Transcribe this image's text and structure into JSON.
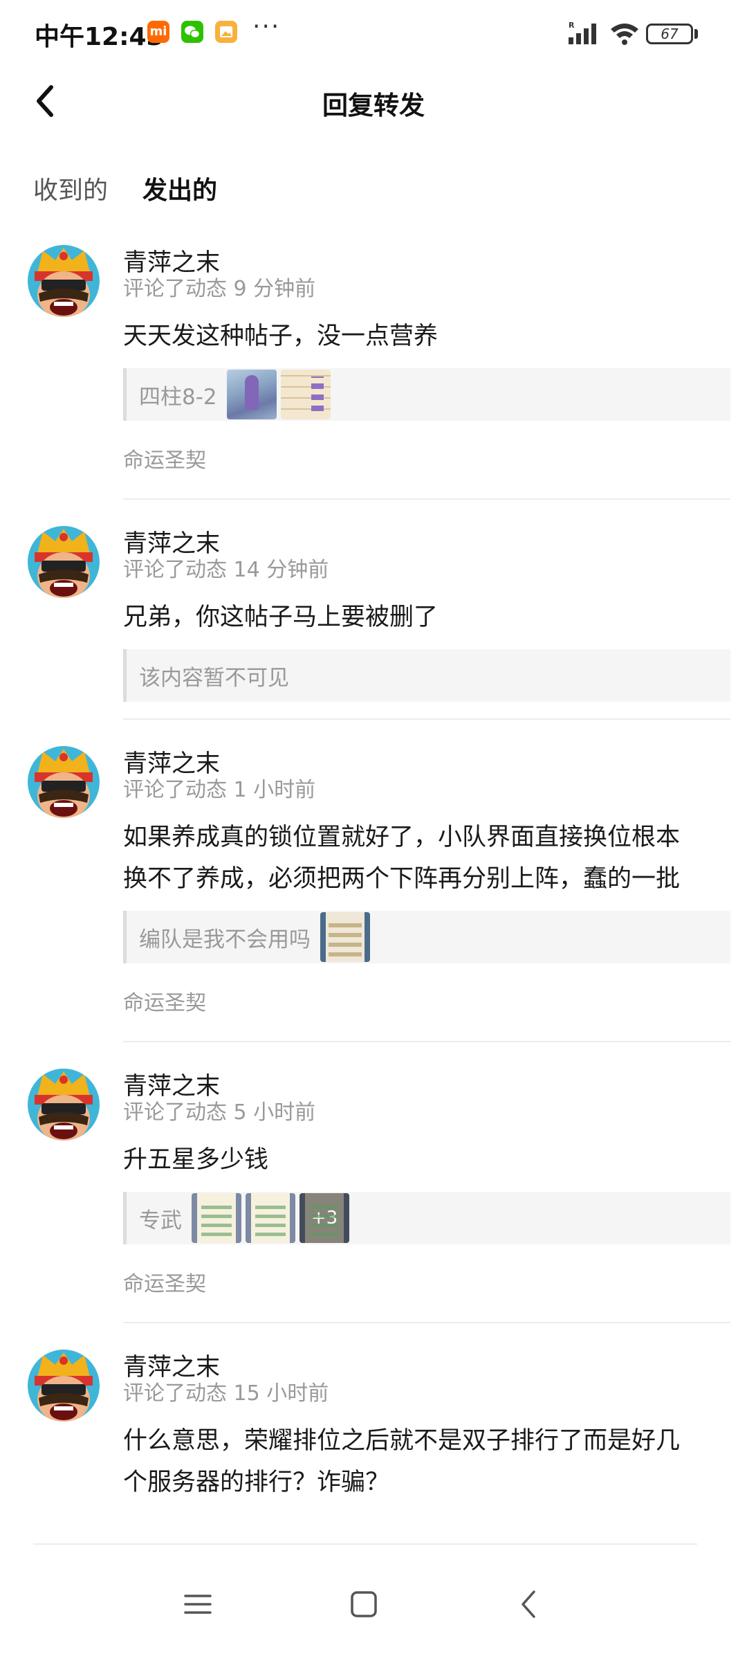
{
  "status_bar": {
    "time": "中午12:43",
    "app_icons": [
      "mi-icon",
      "wechat-icon",
      "gallery-icon"
    ],
    "more": "···",
    "battery": "67"
  },
  "header": {
    "title": "回复转发",
    "back_icon": "chevron-left-icon"
  },
  "tabs": [
    {
      "label": "收到的",
      "active": false
    },
    {
      "label": "发出的",
      "active": true
    }
  ],
  "accent_color": "#1ec9b8",
  "items": [
    {
      "username": "青萍之末",
      "meta": "评论了动态 9 分钟前",
      "content": "天天发这种帖子，没一点营养",
      "quote": {
        "text": "四柱8-2",
        "thumbs": [
          "scene",
          "grid"
        ],
        "more": ""
      },
      "tag": "命运圣契"
    },
    {
      "username": "青萍之末",
      "meta": "评论了动态 14 分钟前",
      "content": "兄弟，你这帖子马上要被删了",
      "quote": {
        "text": "该内容暂不可见",
        "thumbs": [],
        "more": ""
      },
      "tag": ""
    },
    {
      "username": "青萍之末",
      "meta": "评论了动态 1 小时前",
      "content": "如果养成真的锁位置就好了，小队界面直接换位根本换不了养成，必须把两个下阵再分别上阵，蠢的一批",
      "quote": {
        "text": "编队是我不会用吗",
        "thumbs": [
          "list"
        ],
        "more": ""
      },
      "tag": "命运圣契"
    },
    {
      "username": "青萍之末",
      "meta": "评论了动态 5 小时前",
      "content": "升五星多少钱",
      "quote": {
        "text": "专武",
        "thumbs": [
          "chat",
          "chat",
          "chat"
        ],
        "more": "+3"
      },
      "tag": "命运圣契"
    },
    {
      "username": "青萍之末",
      "meta": "评论了动态 15 小时前",
      "content": "什么意思，荣耀排位之后就不是双子排行了而是好几个服务器的排行？诈骗？",
      "quote": null,
      "tag": ""
    }
  ],
  "nav_bar": [
    "menu-icon",
    "home-icon",
    "back-icon"
  ]
}
